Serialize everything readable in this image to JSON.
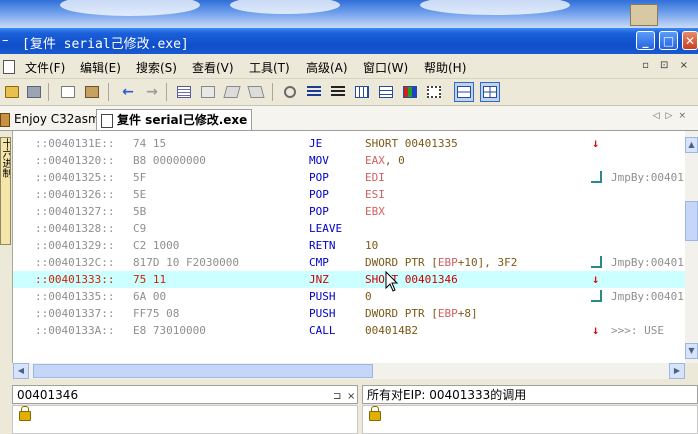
{
  "window": {
    "title_prefix": "–",
    "title": "[复件 serial己修改.exe]",
    "buttons": [
      "_",
      "□",
      "✕"
    ]
  },
  "menu": [
    {
      "label": "文件(F)"
    },
    {
      "label": "编辑(E)"
    },
    {
      "label": "搜索(S)"
    },
    {
      "label": "查看(V)"
    },
    {
      "label": "工具(T)"
    },
    {
      "label": "高级(A)"
    },
    {
      "label": "窗口(W)"
    },
    {
      "label": "帮助(H)"
    }
  ],
  "mdi_controls": "▫ ⊡ ×",
  "tabs": [
    {
      "label": "Enjoy C32asm",
      "active": false
    },
    {
      "label": "复件 serial己修改.exe",
      "active": true
    }
  ],
  "side_tab": {
    "label": "十六进制"
  },
  "disasm": {
    "rows": [
      {
        "addr": "::0040131E::",
        "hex": "74 15",
        "mn": "JE",
        "op": "SHORT 00401335",
        "mark": "down",
        "cmt": ""
      },
      {
        "addr": "::00401320::",
        "hex": "B8 00000000",
        "mn": "MOV",
        "op_reg": "EAX",
        "op_rest": ", 0",
        "mark": "",
        "cmt": ""
      },
      {
        "addr": "::00401325::",
        "hex": "5F",
        "mn": "POP",
        "op_reg": "EDI",
        "op_rest": "",
        "mark": "jmp",
        "cmt": "JmpBy:00401"
      },
      {
        "addr": "::00401326::",
        "hex": "5E",
        "mn": "POP",
        "op_reg": "ESI",
        "op_rest": "",
        "mark": "",
        "cmt": ""
      },
      {
        "addr": "::00401327::",
        "hex": "5B",
        "mn": "POP",
        "op_reg": "EBX",
        "op_rest": "",
        "mark": "",
        "cmt": ""
      },
      {
        "addr": "::00401328::",
        "hex": "C9",
        "mn": "LEAVE",
        "op": "",
        "mark": "",
        "cmt": ""
      },
      {
        "addr": "::00401329::",
        "hex": "C2 1000",
        "mn": "RETN",
        "op": "10",
        "mark": "",
        "cmt": ""
      },
      {
        "addr": "::0040132C::",
        "hex": "817D 10 F2030000",
        "mn": "CMP",
        "op_pre": "DWORD PTR [",
        "op_reg": "EBP",
        "op_rest": "+10], 3F2",
        "mark": "jmp",
        "cmt": "JmpBy:00401"
      },
      {
        "addr": "::00401333::",
        "hex": "75 11",
        "mn": "JNZ",
        "op": "SHORT 00401346",
        "mark": "down",
        "cmt": "",
        "selected": true
      },
      {
        "addr": "::00401335::",
        "hex": "6A 00",
        "mn": "PUSH",
        "op": "0",
        "mark": "jmp",
        "cmt": "JmpBy:00401"
      },
      {
        "addr": "::00401337::",
        "hex": "FF75 08",
        "mn": "PUSH",
        "op_pre": "DWORD PTR [",
        "op_reg": "EBP",
        "op_rest": "+8]",
        "mark": "",
        "cmt": ""
      },
      {
        "addr": "::0040133A::",
        "hex": "E8 73010000",
        "mn": "CALL",
        "op": "004014B2",
        "mark": "down",
        "cmt": ">>>: USE"
      }
    ]
  },
  "panels": {
    "left": {
      "title": "00401346"
    },
    "right": {
      "title": "所有对EIP: 00401333的调用"
    },
    "pin": "⊐"
  },
  "colors": {
    "selected_row": "#ccffff",
    "mnemonic": "#0000c8",
    "register": "#d06060",
    "arrow": "#d81010",
    "titlebar": "#0f4ec9"
  }
}
